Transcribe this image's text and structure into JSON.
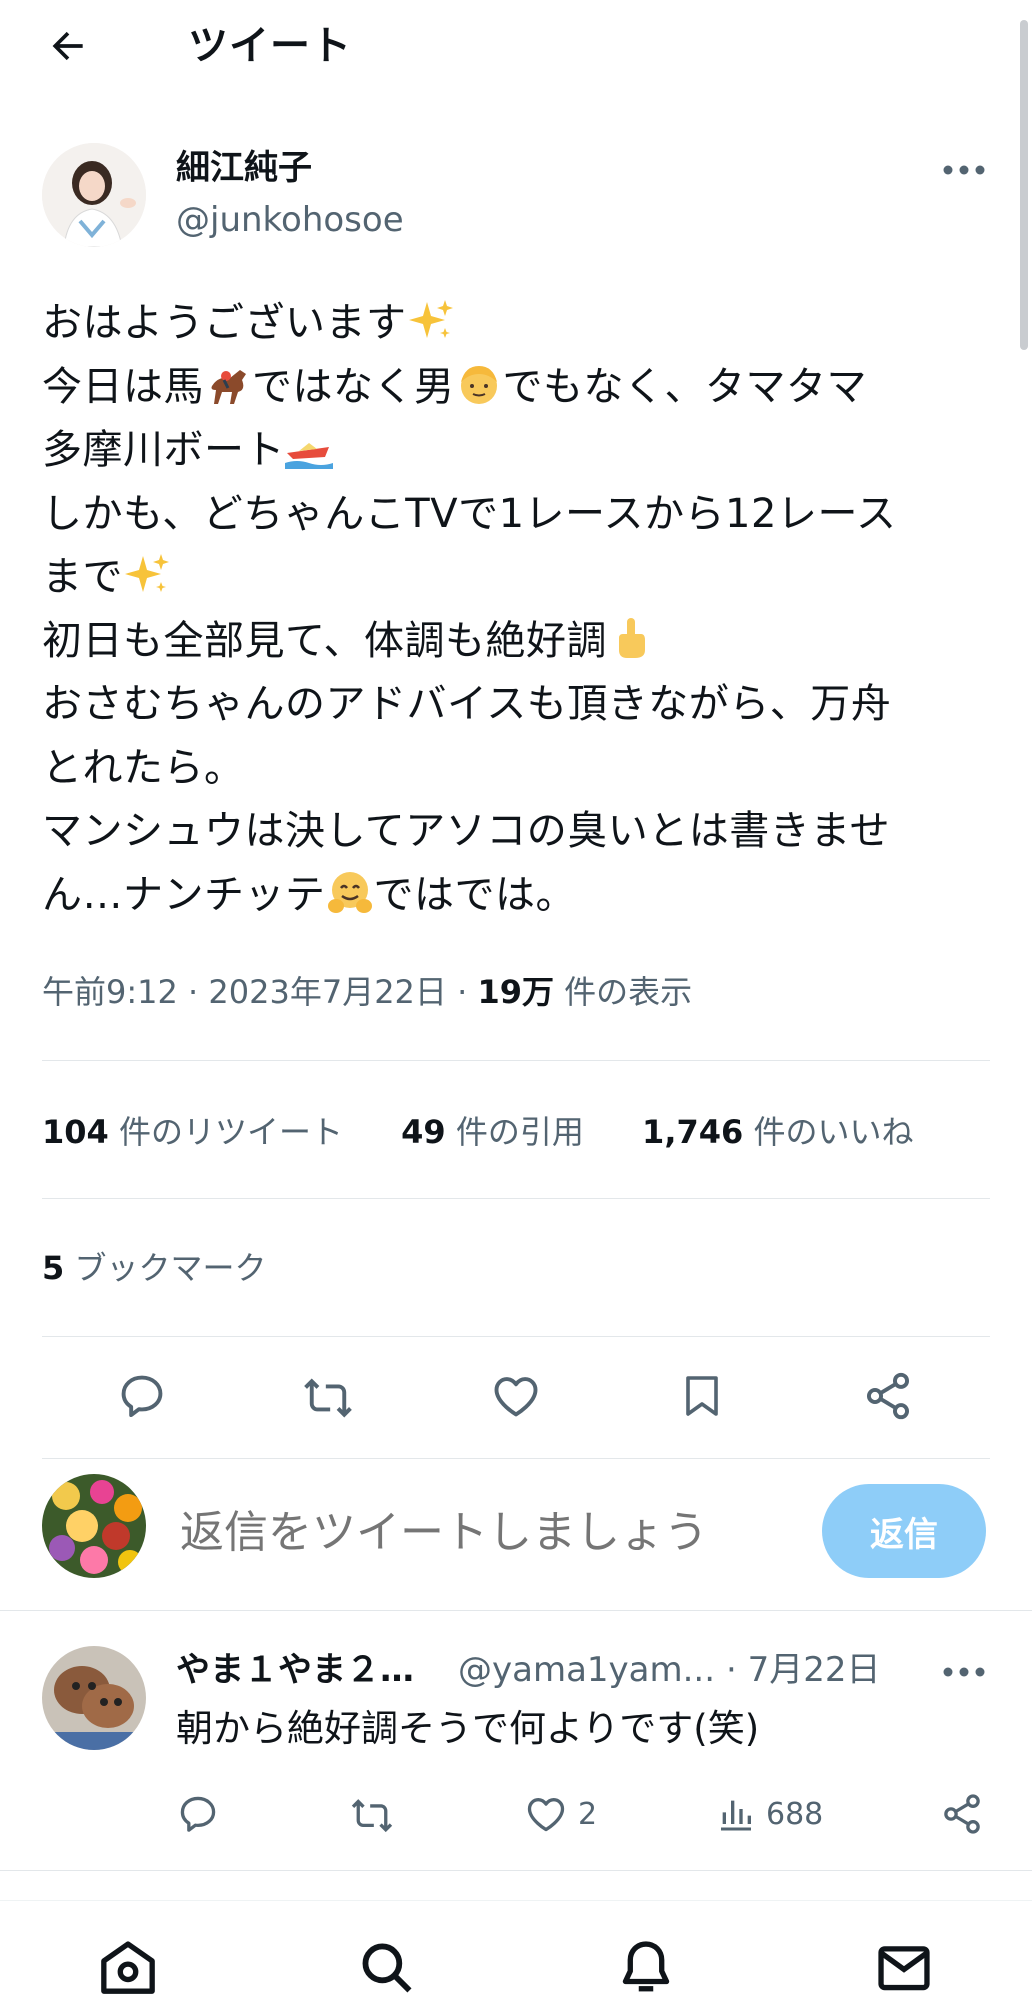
{
  "header": {
    "title": "ツイート",
    "back_icon": "arrow-left-icon"
  },
  "tweet": {
    "author_name": "細江純子",
    "author_handle": "@junkohosoe",
    "more_icon": "more-horizontal-icon",
    "lines": [
      "おはようございます",
      "今日は馬",
      "ではなく男",
      "でもなく、タマタマ",
      "多摩川ボート",
      "しかも、どちゃんこTVで1レースから12レース",
      "まで",
      "初日も全部見て、体調も絶好調",
      "おさむちゃんのアドバイスも頂きながら、万舟",
      "とれたら。",
      "マンシュウは決してアソコの臭いとは書きませ",
      "ん…ナンチッテ",
      "ではでは。"
    ],
    "emojis": [
      "sparkles-emoji",
      "horse-racing-emoji",
      "man-emoji",
      "speedboat-emoji",
      "sparkles-emoji",
      "index-pointing-up-emoji",
      "hugging-face-emoji"
    ],
    "time": "午前9:12",
    "date": "2023年7月22日",
    "views_count": "19万",
    "views_label": "件の表示",
    "retweets_count": "104",
    "retweets_label": "件のリツイート",
    "quotes_count": "49",
    "quotes_label": "件の引用",
    "likes_count": "1,746",
    "likes_label": "件のいいね",
    "bookmarks_count": "5",
    "bookmarks_label": "ブックマーク"
  },
  "actions": [
    "reply-icon",
    "retweet-icon",
    "like-icon",
    "bookmark-icon",
    "share-icon"
  ],
  "composer": {
    "placeholder": "返信をツイートしましょう",
    "reply_button": "返信"
  },
  "reply": {
    "name": "やま１やま２…",
    "handle": "@yama1yam...",
    "date": "· 7月22日",
    "text": "朝から絶好調そうで何よりです(笑)",
    "likes": "2",
    "views": "688"
  },
  "nav": [
    "home-icon",
    "search-icon",
    "notifications-icon",
    "messages-icon"
  ],
  "colors": {
    "text": "#0f1419",
    "secondary": "#536471",
    "reply_button": "#8ecdf8",
    "divider": "#e3e7ea"
  }
}
